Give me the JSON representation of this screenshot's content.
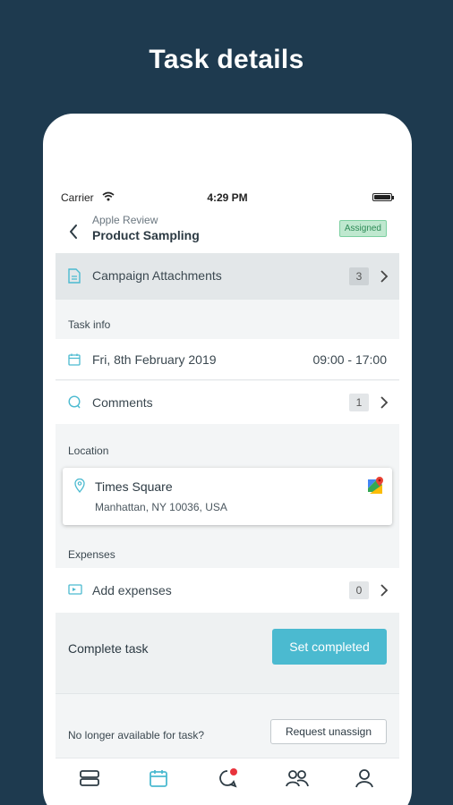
{
  "headline": "Task details",
  "status_bar": {
    "carrier": "Carrier",
    "time": "4:29 PM"
  },
  "nav": {
    "subtitle": "Apple Review",
    "title": "Product Sampling",
    "badge": "Assigned"
  },
  "attachments": {
    "label": "Campaign Attachments",
    "count": "3"
  },
  "task_info": {
    "section": "Task info",
    "date": "Fri, 8th February 2019",
    "time_range": "09:00 - 17:00",
    "comments_label": "Comments",
    "comments_count": "1"
  },
  "location": {
    "section": "Location",
    "name": "Times Square",
    "address": "Manhattan, NY 10036, USA"
  },
  "expenses": {
    "section": "Expenses",
    "label": "Add expenses",
    "count": "0"
  },
  "complete": {
    "label": "Complete task",
    "button": "Set completed"
  },
  "unassign": {
    "text": "No longer available for task?",
    "button": "Request unassign"
  },
  "tabs": [
    "tasks-icon",
    "calendar-icon",
    "chat-icon",
    "team-icon",
    "profile-icon"
  ],
  "colors": {
    "background": "#1e3a4f",
    "accent": "#4bbad0",
    "badge_bg": "#bfe8cf",
    "badge_text": "#2e8b57",
    "notification": "#e8333c"
  }
}
